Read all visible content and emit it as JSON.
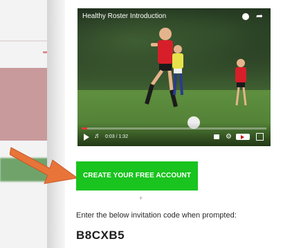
{
  "video": {
    "title": "Healthy Roster Introduction",
    "time": "0:03 / 1:32",
    "progress": 0.03
  },
  "cta": {
    "label": "CREATE YOUR FREE ACCOUNT"
  },
  "divider": {
    "symbol": "+"
  },
  "invite": {
    "instruction": "Enter the below invitation code when prompted:",
    "code": "B8CXB5"
  },
  "colors": {
    "cta": "#19c41e",
    "arrow": "#e8743a",
    "progress": "#e53935"
  },
  "icons": [
    "clock-icon",
    "share-icon",
    "play-icon",
    "volume-icon",
    "cc-icon",
    "gear-icon",
    "youtube-icon",
    "fullscreen-icon",
    "arrow-pointer"
  ]
}
